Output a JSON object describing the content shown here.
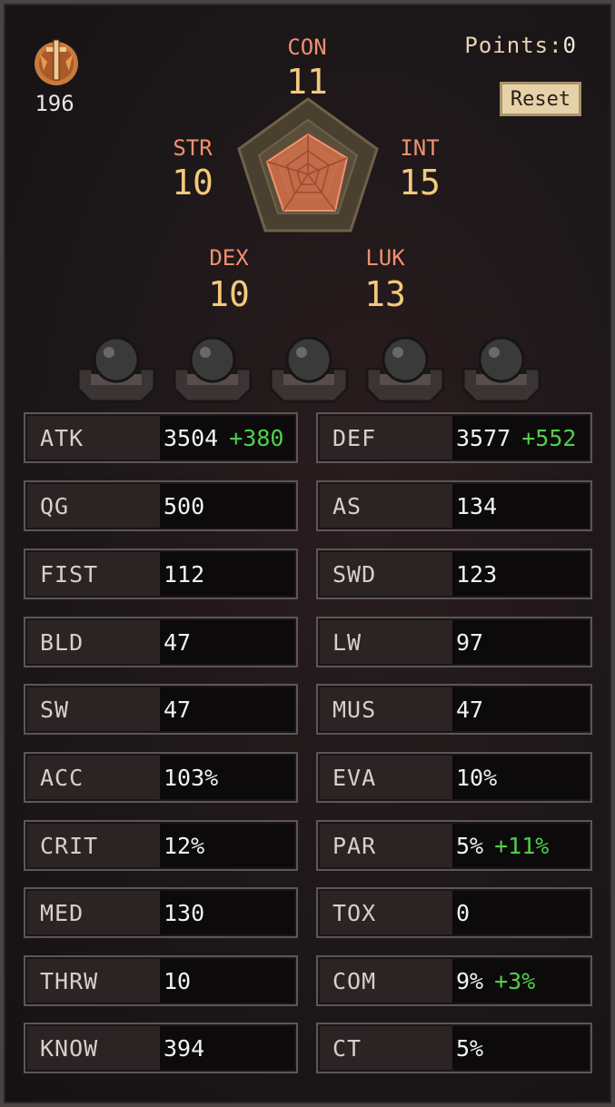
{
  "header": {
    "emblem_icon": "sword-medallion-icon",
    "level": "196",
    "points_label": "Points:",
    "points_value": "0",
    "reset_label": "Reset"
  },
  "attributes": {
    "con": {
      "name": "CON",
      "value": "11"
    },
    "str": {
      "name": "STR",
      "value": "10"
    },
    "int": {
      "name": "INT",
      "value": "15"
    },
    "dex": {
      "name": "DEX",
      "value": "10"
    },
    "luk": {
      "name": "LUK",
      "value": "13"
    }
  },
  "slots": [
    "orb-slot-icon",
    "orb-slot-icon",
    "orb-slot-icon",
    "orb-slot-icon",
    "orb-slot-icon"
  ],
  "stats_left": [
    {
      "label": "ATK",
      "value": "3504",
      "bonus": "+380"
    },
    {
      "label": "QG",
      "value": "500",
      "bonus": ""
    },
    {
      "label": "FIST",
      "value": "112",
      "bonus": ""
    },
    {
      "label": "BLD",
      "value": "47",
      "bonus": ""
    },
    {
      "label": "SW",
      "value": "47",
      "bonus": ""
    },
    {
      "label": "ACC",
      "value": "103%",
      "bonus": ""
    },
    {
      "label": "CRIT",
      "value": "12%",
      "bonus": ""
    },
    {
      "label": "MED",
      "value": "130",
      "bonus": ""
    },
    {
      "label": "THRW",
      "value": "10",
      "bonus": ""
    },
    {
      "label": "KNOW",
      "value": "394",
      "bonus": ""
    }
  ],
  "stats_right": [
    {
      "label": "DEF",
      "value": "3577",
      "bonus": "+552"
    },
    {
      "label": "AS",
      "value": "134",
      "bonus": ""
    },
    {
      "label": "SWD",
      "value": "123",
      "bonus": ""
    },
    {
      "label": "LW",
      "value": "97",
      "bonus": ""
    },
    {
      "label": "MUS",
      "value": "47",
      "bonus": ""
    },
    {
      "label": "EVA",
      "value": "10%",
      "bonus": ""
    },
    {
      "label": "PAR",
      "value": "5%",
      "bonus": "+11%"
    },
    {
      "label": "TOX",
      "value": "0",
      "bonus": ""
    },
    {
      "label": "COM",
      "value": "9%",
      "bonus": "+3%"
    },
    {
      "label": "CT",
      "value": "5%",
      "bonus": ""
    }
  ],
  "colors": {
    "attr_name": "#f09070",
    "attr_value": "#f3c97a",
    "bonus": "#4fd04a",
    "radar_fill": "#e07a55"
  }
}
